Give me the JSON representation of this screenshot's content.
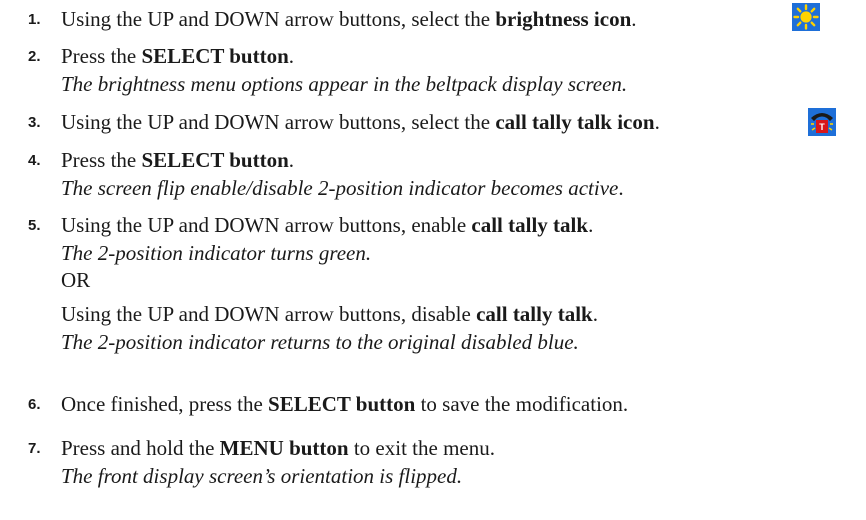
{
  "steps": [
    {
      "number": "1.",
      "main_pre": "Using the UP and DOWN arrow buttons, select the ",
      "main_bold": "brightness icon",
      "main_post": ".",
      "icon": "sun-brightness-icon"
    },
    {
      "number": "2.",
      "main_pre": "Press the ",
      "main_bold": "SELECT button",
      "main_post": ".",
      "note": "The brightness menu options appear in the beltpack display screen."
    },
    {
      "number": "3.",
      "main_pre": "Using the UP and DOWN arrow buttons, select the ",
      "main_bold": "call tally talk icon",
      "main_post": ".",
      "icon": "call-tally-talk-icon"
    },
    {
      "number": "4.",
      "main_pre": "Press the ",
      "main_bold": "SELECT button",
      "main_post": ".",
      "note": "The screen flip enable/disable 2-position indicator becomes active",
      "note_post": "."
    },
    {
      "number": "5.",
      "main_pre": "Using the UP and DOWN arrow buttons, enable ",
      "main_bold": "call tally talk",
      "main_post": ".",
      "note": "The 2-position indicator turns green.",
      "or": "OR",
      "alt_pre": "Using the UP and DOWN arrow buttons, disable ",
      "alt_bold": "call tally talk",
      "alt_post": ".",
      "alt_note": "The 2-position indicator returns to the original disabled blue."
    },
    {
      "number": "6.",
      "main_pre": "Once finished, press the ",
      "main_bold": "SELECT button",
      "main_post": " to save the modification."
    },
    {
      "number": "7.",
      "main_pre": "Press and hold the ",
      "main_bold": "MENU button",
      "main_post": " to exit the menu.",
      "note": "The front display screen’s orientation is flipped."
    }
  ]
}
